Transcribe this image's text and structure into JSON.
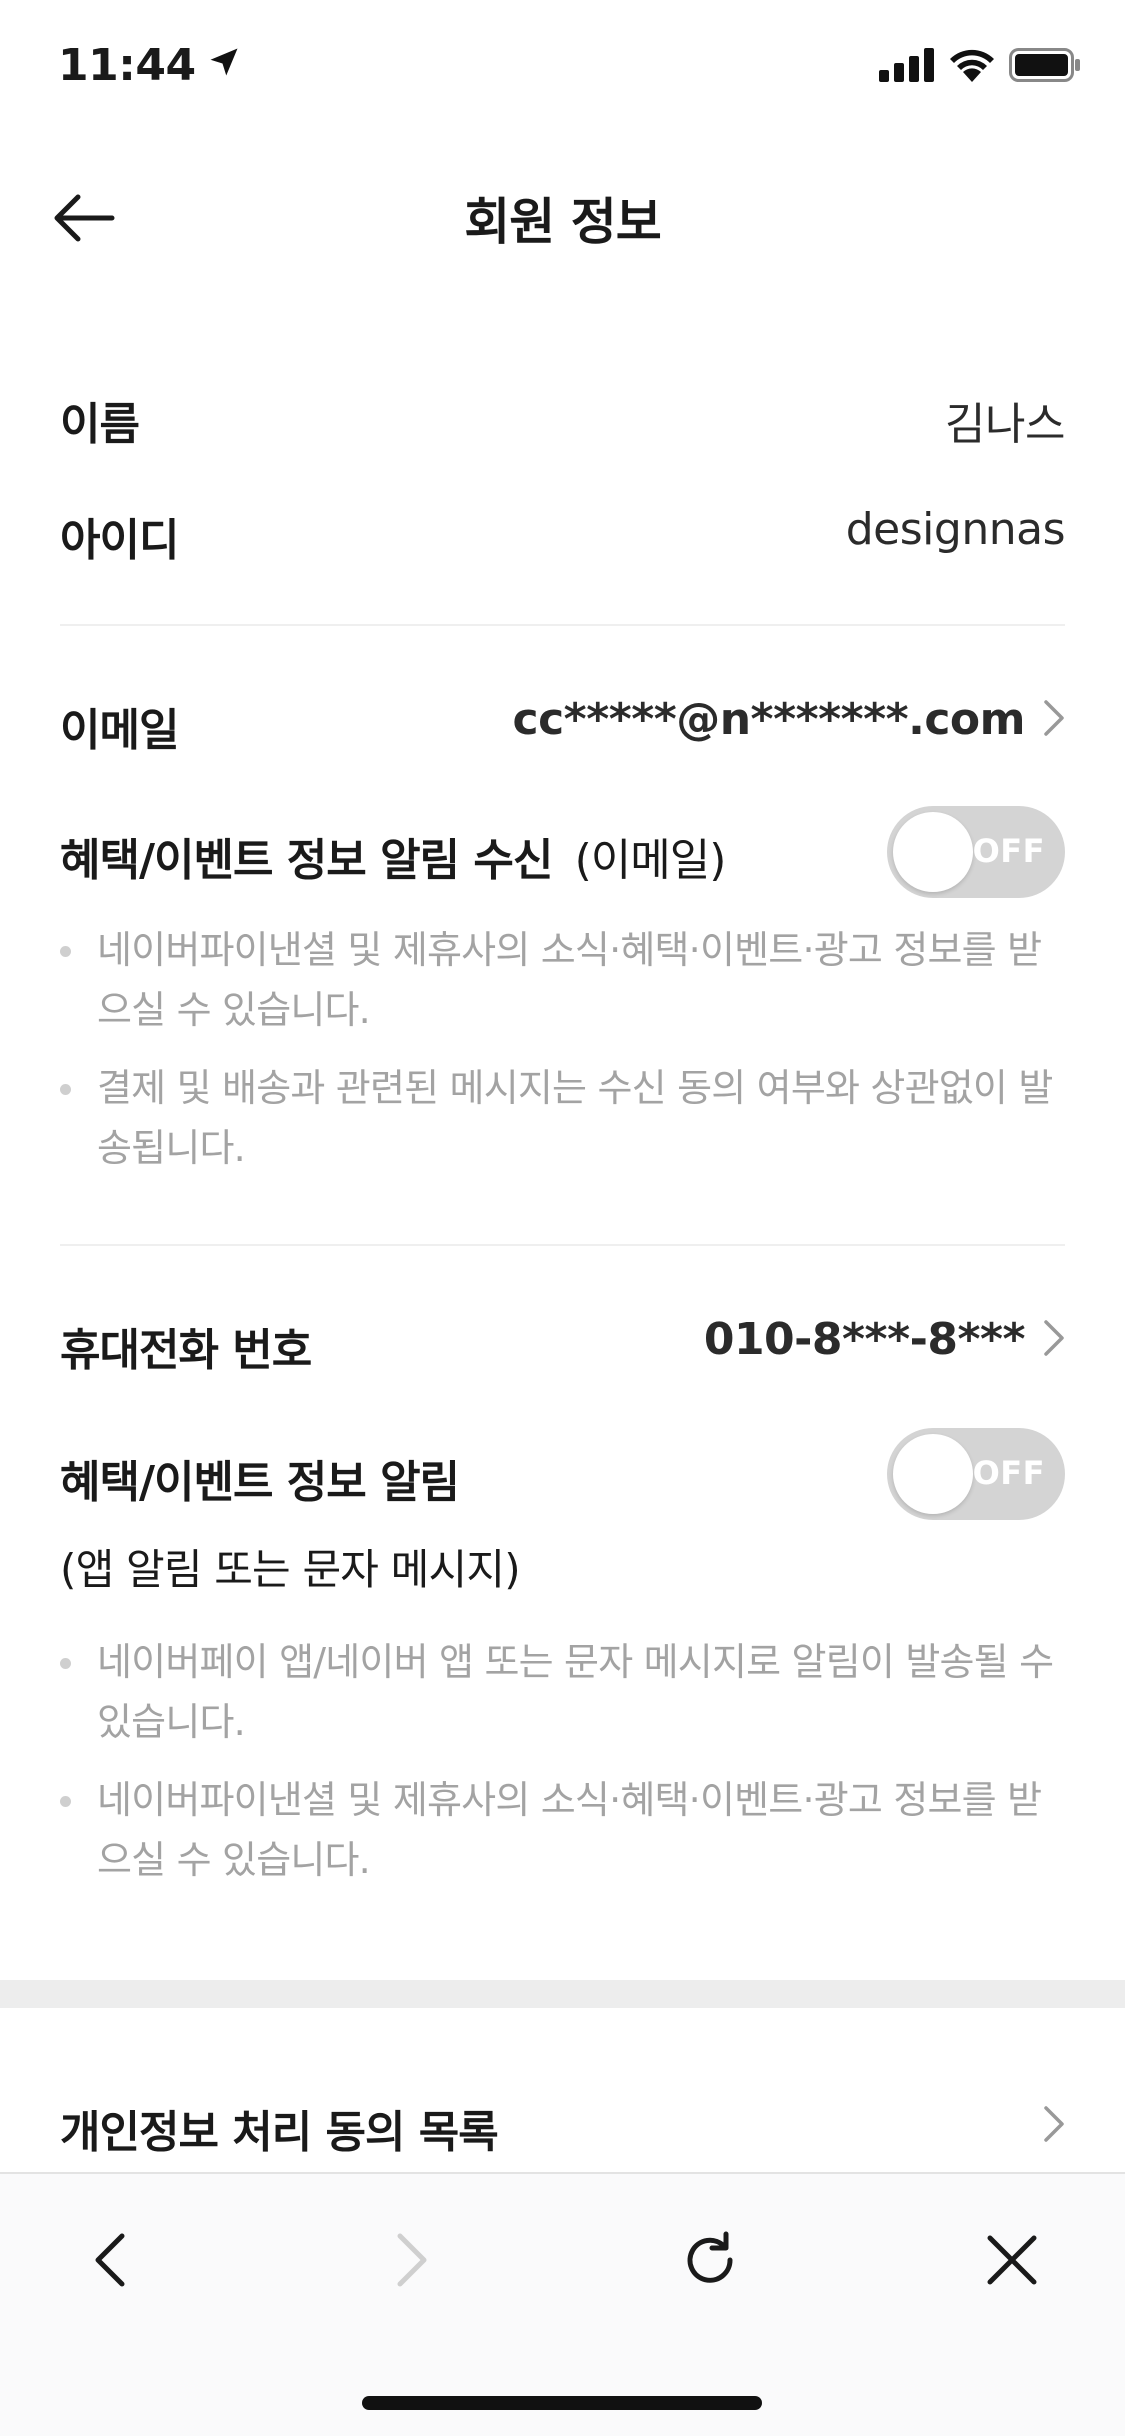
{
  "status_bar": {
    "time": "11:44",
    "icons": [
      "location-arrow-icon",
      "signal-icon",
      "wifi-icon",
      "battery-icon"
    ]
  },
  "header": {
    "title": "회원 정보",
    "back_icon": "back-arrow-icon"
  },
  "profile": {
    "name_label": "이름",
    "name_value": "김나스",
    "id_label": "아이디",
    "id_value": "designnas"
  },
  "email_section": {
    "label": "이메일",
    "value": "cc*****@n*******.com",
    "toggle_label": "혜택/이벤트 정보 알림 수신",
    "toggle_label_suffix": "(이메일)",
    "toggle_state": "OFF",
    "notes": [
      "네이버파이낸셜 및 제휴사의 소식·혜택·이벤트·광고 정보를 받으실 수 있습니다.",
      "결제 및 배송과 관련된 메시지는 수신 동의 여부와 상관없이 발송됩니다."
    ]
  },
  "phone_section": {
    "label": "휴대전화 번호",
    "value": "010-8***-8***",
    "toggle_label": "혜택/이벤트 정보 알림",
    "toggle_sub": "(앱 알림 또는 문자 메시지)",
    "toggle_state": "OFF",
    "notes": [
      "네이버페이 앱/네이버 앱 또는 문자 메시지로 알림이 발송될 수 있습니다.",
      "네이버파이낸셜 및 제휴사의 소식·혜택·이벤트·광고 정보를 받으실 수 있습니다."
    ]
  },
  "privacy": {
    "label": "개인정보 처리 동의 목록"
  },
  "browser_bar": {
    "buttons": [
      "back-icon",
      "forward-icon",
      "refresh-icon",
      "close-icon"
    ]
  },
  "colors": {
    "text": "#1a1a1a",
    "muted": "#a3a3a3",
    "toggle_off": "#d4d4d4",
    "divider": "#efefef"
  }
}
